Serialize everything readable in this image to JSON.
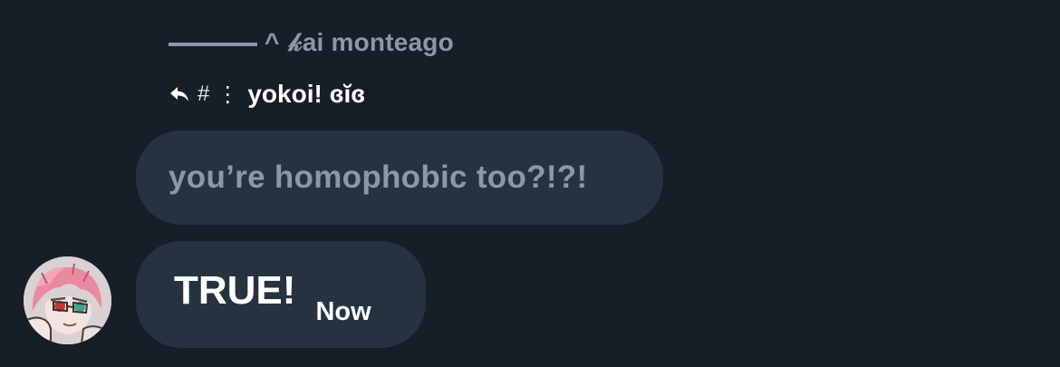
{
  "reply_context": {
    "prefix": "^",
    "author": "𝓀ai monteago"
  },
  "reply_target": {
    "hash": "#",
    "separator": "⋮",
    "name": "yokoi! ɞĭɞ"
  },
  "quoted_message": {
    "text": "you’re homophobic too?!?!"
  },
  "message": {
    "text": "TRUE!",
    "time": "Now"
  },
  "colors": {
    "background": "#161e28",
    "bubble": "#263240",
    "muted_text": "#8b98a5",
    "primary_text": "#ffffff"
  },
  "icons": {
    "reply": "reply-arrow-icon",
    "avatar": "anime-avatar"
  }
}
